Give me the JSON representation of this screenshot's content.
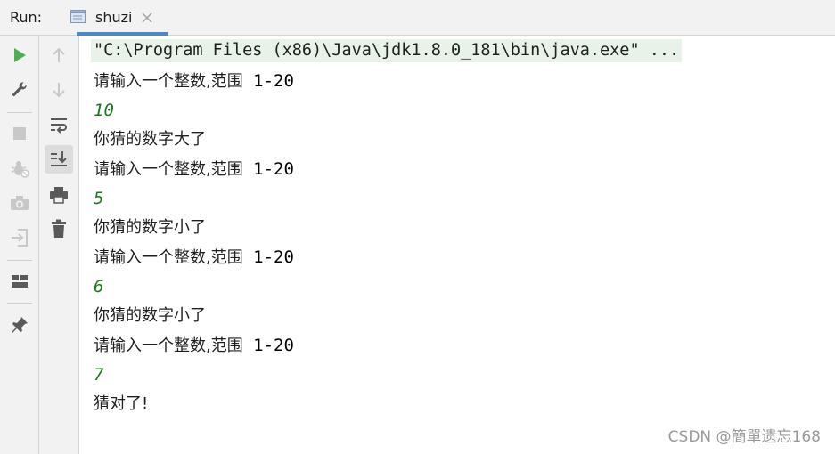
{
  "header": {
    "run_label": "Run:",
    "tab_label": "shuzi"
  },
  "console": {
    "command": "\"C:\\Program Files (x86)\\Java\\jdk1.8.0_181\\bin\\java.exe\" ...",
    "prompt_cn": "请输入一个整数,范围",
    "prompt_range": " 1-20",
    "lines": [
      {
        "kind": "input",
        "text": "10"
      },
      {
        "kind": "msg",
        "text": "你猜的数字大了"
      },
      {
        "kind": "input",
        "text": "5"
      },
      {
        "kind": "msg",
        "text": "你猜的数字小了"
      },
      {
        "kind": "input",
        "text": "6"
      },
      {
        "kind": "msg",
        "text": "你猜的数字小了"
      },
      {
        "kind": "input",
        "text": "7"
      },
      {
        "kind": "msg",
        "text": "猜对了!"
      }
    ]
  },
  "watermark": "CSDN @簡單遗忘168",
  "colors": {
    "run_green": "#4caf50",
    "input_green": "#1c7a1c",
    "tab_underline": "#4a88c7",
    "command_bg": "#e8f2e8"
  },
  "icons": {
    "toolbar_a": [
      "play-icon",
      "wrench-icon",
      "stop-icon",
      "debug-icon",
      "camera-icon",
      "exit-icon",
      "layout-icon",
      "pin-icon"
    ],
    "toolbar_b": [
      "arrow-up-icon",
      "arrow-down-icon",
      "soft-wrap-icon",
      "scroll-to-end-icon",
      "print-icon",
      "trash-icon"
    ]
  }
}
